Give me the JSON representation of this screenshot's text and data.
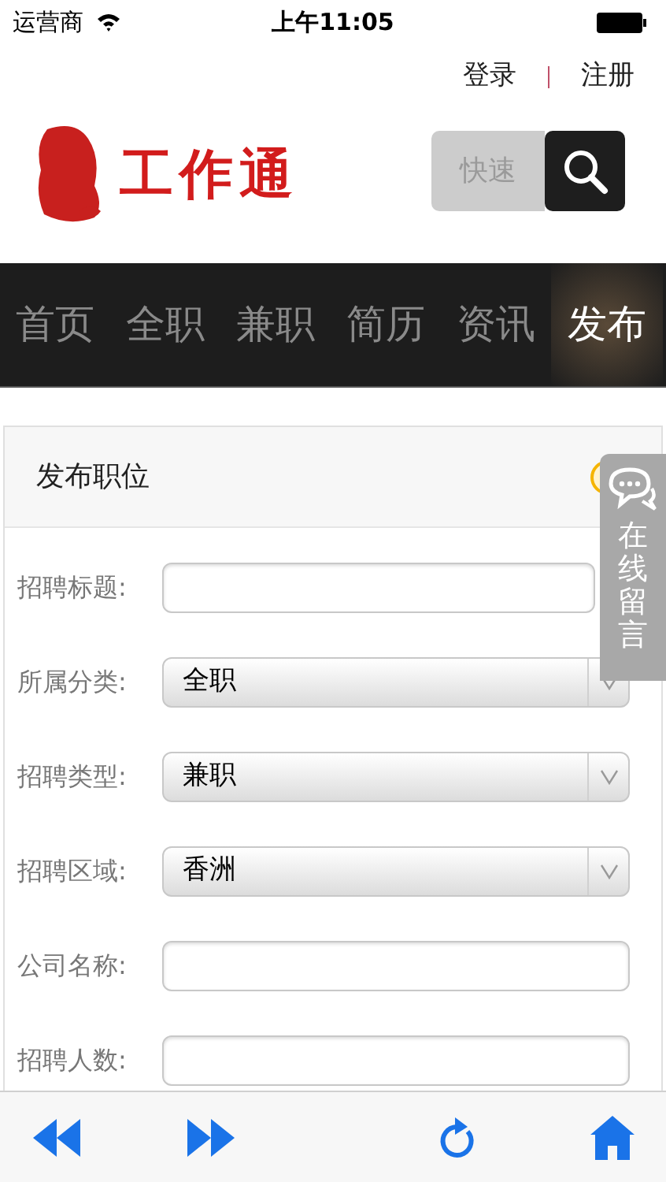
{
  "status_bar": {
    "carrier": "运营商",
    "time": "上午11:05"
  },
  "header": {
    "links": [
      "登录",
      "注册"
    ],
    "logo_text": "工作通",
    "search_button": "快速"
  },
  "nav": [
    {
      "label": "首页",
      "selected": false
    },
    {
      "label": "全职",
      "selected": false
    },
    {
      "label": "兼职",
      "selected": false
    },
    {
      "label": "简历",
      "selected": false
    },
    {
      "label": "资讯",
      "selected": false
    },
    {
      "label": "发布",
      "selected": true
    }
  ],
  "panel": {
    "title": "发布职位"
  },
  "form": [
    {
      "label": "招聘标题:",
      "kind": "text"
    },
    {
      "label": "所属分类:",
      "kind": "select",
      "value": "全职"
    },
    {
      "label": "招聘类型:",
      "kind": "select",
      "value": "兼职"
    },
    {
      "label": "招聘区域:",
      "kind": "select",
      "value": "香洲"
    },
    {
      "label": "公司名称:",
      "kind": "text"
    },
    {
      "label": "招聘人数:",
      "kind": "text"
    }
  ],
  "side_tab": {
    "label": "在线留言"
  }
}
